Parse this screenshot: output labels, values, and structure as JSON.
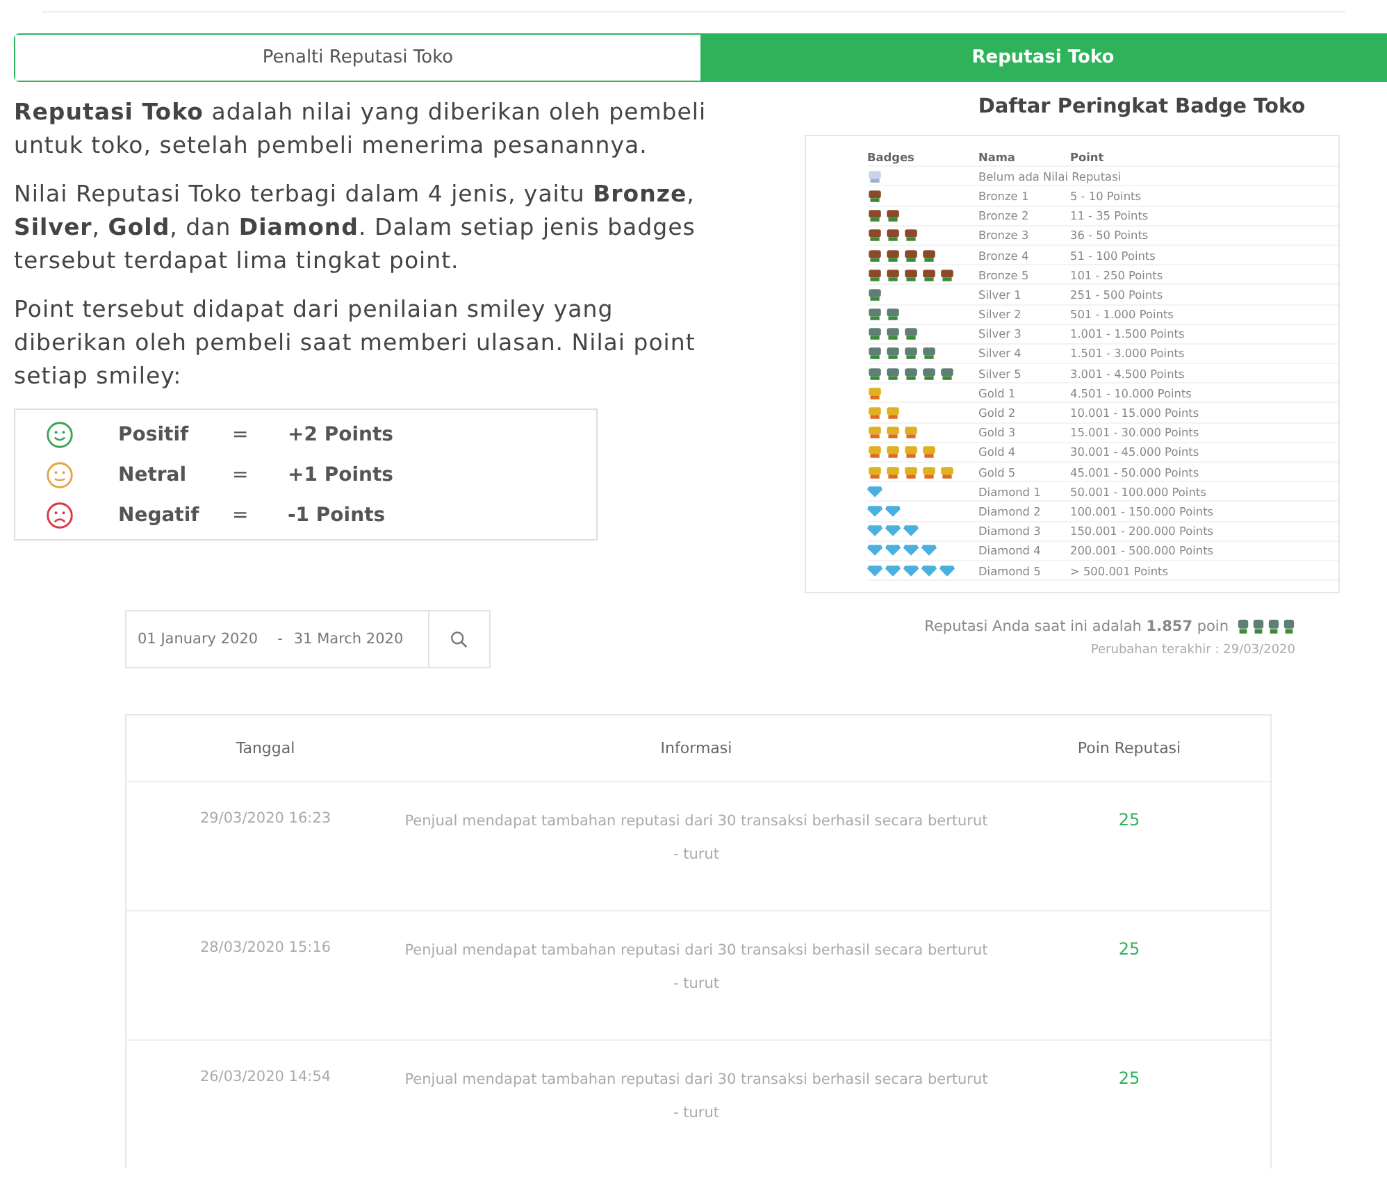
{
  "tabs": [
    {
      "label": "Penalti Reputasi Toko",
      "selected": false
    },
    {
      "label": "Reputasi Toko",
      "selected": true
    }
  ],
  "intro": [
    "**Reputasi Toko** adalah nilai yang diberikan oleh pembeli untuk toko, setelah pembeli menerima pesanannya.",
    "Nilai Reputasi Toko terbagi dalam 4 jenis, yaitu **Bronze**, **Silver**, **Gold**, dan **Diamond**. Dalam setiap jenis badges tersebut terdapat lima tingkat point.",
    "Point tersebut didapat dari penilaian smiley yang diberikan oleh pembeli saat memberi ulasan. Nilai point setiap smiley:"
  ],
  "smileys": [
    {
      "kind": "positive",
      "color": "#3aa655",
      "label": "Positif",
      "eq": "=",
      "points": "+2 Points"
    },
    {
      "kind": "neutral",
      "color": "#e8a34a",
      "label": "Netral",
      "eq": "=",
      "points": "+1 Points"
    },
    {
      "kind": "negative",
      "color": "#d9363e",
      "label": "Negatif",
      "eq": "=",
      "points": "-1 Points"
    }
  ],
  "badge_list": {
    "title": "Daftar Peringkat Badge Toko",
    "columns": [
      "Badges",
      "Nama",
      "Point"
    ],
    "rows": [
      {
        "badges": [
          {
            "kind": "none"
          }
        ],
        "name": "Belum ada Nilai Reputasi"
      },
      {
        "badges": [
          {
            "kind": "bronze"
          }
        ],
        "name": "Bronze 1",
        "point": "5 - 10 Points"
      },
      {
        "badges": [
          {
            "kind": "bronze"
          },
          {
            "kind": "bronze"
          }
        ],
        "name": "Bronze 2",
        "point": "11 - 35 Points"
      },
      {
        "badges": [
          {
            "kind": "bronze"
          },
          {
            "kind": "bronze"
          },
          {
            "kind": "bronze"
          }
        ],
        "name": "Bronze 3",
        "point": "36 - 50 Points"
      },
      {
        "badges": [
          {
            "kind": "bronze"
          },
          {
            "kind": "bronze"
          },
          {
            "kind": "bronze"
          },
          {
            "kind": "bronze"
          }
        ],
        "name": "Bronze 4",
        "point": "51 - 100 Points"
      },
      {
        "badges": [
          {
            "kind": "bronze"
          },
          {
            "kind": "bronze"
          },
          {
            "kind": "bronze"
          },
          {
            "kind": "bronze"
          },
          {
            "kind": "bronze"
          }
        ],
        "name": "Bronze 5",
        "point": "101 - 250 Points"
      },
      {
        "badges": [
          {
            "kind": "silver"
          }
        ],
        "name": "Silver 1",
        "point": "251 - 500 Points"
      },
      {
        "badges": [
          {
            "kind": "silver"
          },
          {
            "kind": "silver"
          }
        ],
        "name": "Silver 2",
        "point": "501 - 1.000 Points"
      },
      {
        "badges": [
          {
            "kind": "silver"
          },
          {
            "kind": "silver"
          },
          {
            "kind": "silver"
          }
        ],
        "name": "Silver 3",
        "point": "1.001 - 1.500 Points"
      },
      {
        "badges": [
          {
            "kind": "silver"
          },
          {
            "kind": "silver"
          },
          {
            "kind": "silver"
          },
          {
            "kind": "silver"
          }
        ],
        "name": "Silver 4",
        "point": "1.501 - 3.000 Points"
      },
      {
        "badges": [
          {
            "kind": "silver"
          },
          {
            "kind": "silver"
          },
          {
            "kind": "silver"
          },
          {
            "kind": "silver"
          },
          {
            "kind": "silver"
          }
        ],
        "name": "Silver 5",
        "point": "3.001 - 4.500 Points"
      },
      {
        "badges": [
          {
            "kind": "gold"
          }
        ],
        "name": "Gold 1",
        "point": "4.501 - 10.000 Points"
      },
      {
        "badges": [
          {
            "kind": "gold"
          },
          {
            "kind": "gold"
          }
        ],
        "name": "Gold 2",
        "point": "10.001 - 15.000 Points"
      },
      {
        "badges": [
          {
            "kind": "gold"
          },
          {
            "kind": "gold"
          },
          {
            "kind": "gold"
          }
        ],
        "name": "Gold 3",
        "point": "15.001 - 30.000 Points"
      },
      {
        "badges": [
          {
            "kind": "gold"
          },
          {
            "kind": "gold"
          },
          {
            "kind": "gold"
          },
          {
            "kind": "gold"
          }
        ],
        "name": "Gold 4",
        "point": "30.001 - 45.000 Points"
      },
      {
        "badges": [
          {
            "kind": "gold"
          },
          {
            "kind": "gold"
          },
          {
            "kind": "gold"
          },
          {
            "kind": "gold"
          },
          {
            "kind": "gold"
          }
        ],
        "name": "Gold 5",
        "point": "45.001 - 50.000 Points"
      },
      {
        "badges": [
          {
            "kind": "diamond"
          }
        ],
        "name": "Diamond 1",
        "point": "50.001 - 100.000 Points"
      },
      {
        "badges": [
          {
            "kind": "diamond"
          },
          {
            "kind": "diamond"
          }
        ],
        "name": "Diamond 2",
        "point": "100.001 - 150.000 Points"
      },
      {
        "badges": [
          {
            "kind": "diamond"
          },
          {
            "kind": "diamond"
          },
          {
            "kind": "diamond"
          }
        ],
        "name": "Diamond 3",
        "point": "150.001 - 200.000 Points"
      },
      {
        "badges": [
          {
            "kind": "diamond"
          },
          {
            "kind": "diamond"
          },
          {
            "kind": "diamond"
          },
          {
            "kind": "diamond"
          }
        ],
        "name": "Diamond 4",
        "point": "200.001 - 500.000 Points"
      },
      {
        "badges": [
          {
            "kind": "diamond"
          },
          {
            "kind": "diamond"
          },
          {
            "kind": "diamond"
          },
          {
            "kind": "diamond"
          },
          {
            "kind": "diamond"
          }
        ],
        "name": "Diamond 5",
        "point": "> 500.001 Points"
      }
    ]
  },
  "date_filter": {
    "start": "01 January 2020",
    "separator": "-",
    "end": "31 March 2020"
  },
  "current": {
    "text": "Reputasi Anda saat ini adalah **1.857** poin",
    "badges": [
      {
        "kind": "silver"
      },
      {
        "kind": "silver"
      },
      {
        "kind": "silver"
      },
      {
        "kind": "silver"
      }
    ],
    "updated": "Perubahan terakhir : 29/03/2020"
  },
  "history": {
    "columns": [
      "Tanggal",
      "Informasi",
      "Poin Reputasi"
    ],
    "rows": [
      {
        "date": "29/03/2020 16:23",
        "info": "Penjual mendapat tambahan reputasi dari 30 transaksi berhasil secara berturut - turut",
        "points": "25"
      },
      {
        "date": "28/03/2020 15:16",
        "info": "Penjual mendapat tambahan reputasi dari 30 transaksi berhasil secara berturut - turut",
        "points": "25"
      },
      {
        "date": "26/03/2020 14:54",
        "info": "Penjual mendapat tambahan reputasi dari 30 transaksi berhasil secara berturut - turut",
        "points": "25"
      }
    ]
  }
}
